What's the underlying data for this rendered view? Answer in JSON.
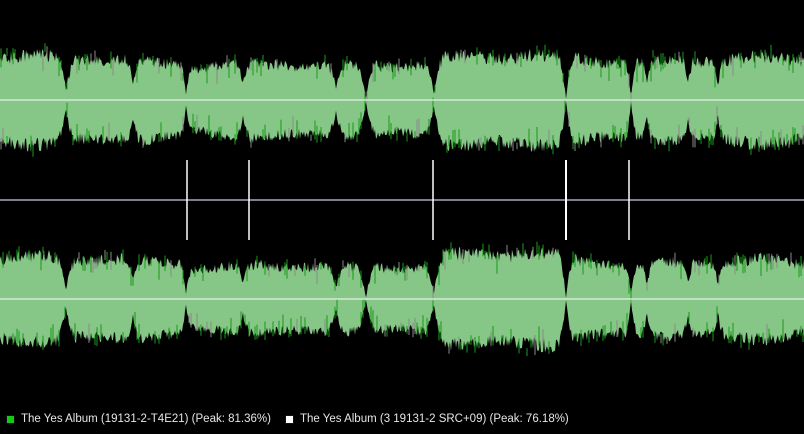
{
  "legend": [
    {
      "label": "The Yes Album (19131-2-T4E21) (Peak: 81.36%)",
      "color": "#18c818"
    },
    {
      "label": "The Yes Album (3 19131-2 SRC+09) (Peak: 76.18%)",
      "color": "#ffffff"
    }
  ],
  "colors": {
    "background": "#000000",
    "waveform_fill": "#86c687",
    "waveform_spike": "#1a9a1a",
    "center_line": "#d4ead6",
    "divider": "#a9a9c6",
    "track_marker": "#ffffff"
  },
  "channels": [
    "top",
    "bottom"
  ],
  "track_boundaries": [
    0.232,
    0.31,
    0.538,
    0.704,
    0.782
  ],
  "waveform_levels": [
    {
      "segment": 1,
      "top": 0.74,
      "bottom": 0.72
    },
    {
      "segment": 2,
      "top": 0.63,
      "bottom": 0.58
    },
    {
      "segment": 3,
      "top": 0.69,
      "bottom": 0.64
    },
    {
      "segment": 4,
      "top": 0.77,
      "bottom": 0.78
    },
    {
      "segment": 5,
      "top": 0.77,
      "bottom": 0.71
    },
    {
      "segment": 6,
      "top": 0.72,
      "bottom": 0.66
    }
  ]
}
